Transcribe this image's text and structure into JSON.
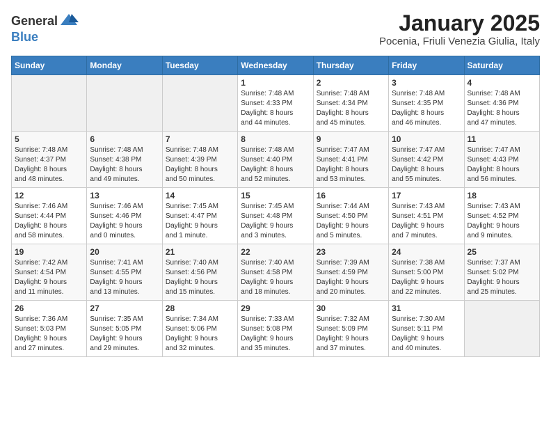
{
  "header": {
    "logo_general": "General",
    "logo_blue": "Blue",
    "title": "January 2025",
    "subtitle": "Pocenia, Friuli Venezia Giulia, Italy"
  },
  "days_of_week": [
    "Sunday",
    "Monday",
    "Tuesday",
    "Wednesday",
    "Thursday",
    "Friday",
    "Saturday"
  ],
  "weeks": [
    [
      {
        "day": "",
        "info": ""
      },
      {
        "day": "",
        "info": ""
      },
      {
        "day": "",
        "info": ""
      },
      {
        "day": "1",
        "info": "Sunrise: 7:48 AM\nSunset: 4:33 PM\nDaylight: 8 hours\nand 44 minutes."
      },
      {
        "day": "2",
        "info": "Sunrise: 7:48 AM\nSunset: 4:34 PM\nDaylight: 8 hours\nand 45 minutes."
      },
      {
        "day": "3",
        "info": "Sunrise: 7:48 AM\nSunset: 4:35 PM\nDaylight: 8 hours\nand 46 minutes."
      },
      {
        "day": "4",
        "info": "Sunrise: 7:48 AM\nSunset: 4:36 PM\nDaylight: 8 hours\nand 47 minutes."
      }
    ],
    [
      {
        "day": "5",
        "info": "Sunrise: 7:48 AM\nSunset: 4:37 PM\nDaylight: 8 hours\nand 48 minutes."
      },
      {
        "day": "6",
        "info": "Sunrise: 7:48 AM\nSunset: 4:38 PM\nDaylight: 8 hours\nand 49 minutes."
      },
      {
        "day": "7",
        "info": "Sunrise: 7:48 AM\nSunset: 4:39 PM\nDaylight: 8 hours\nand 50 minutes."
      },
      {
        "day": "8",
        "info": "Sunrise: 7:48 AM\nSunset: 4:40 PM\nDaylight: 8 hours\nand 52 minutes."
      },
      {
        "day": "9",
        "info": "Sunrise: 7:47 AM\nSunset: 4:41 PM\nDaylight: 8 hours\nand 53 minutes."
      },
      {
        "day": "10",
        "info": "Sunrise: 7:47 AM\nSunset: 4:42 PM\nDaylight: 8 hours\nand 55 minutes."
      },
      {
        "day": "11",
        "info": "Sunrise: 7:47 AM\nSunset: 4:43 PM\nDaylight: 8 hours\nand 56 minutes."
      }
    ],
    [
      {
        "day": "12",
        "info": "Sunrise: 7:46 AM\nSunset: 4:44 PM\nDaylight: 8 hours\nand 58 minutes."
      },
      {
        "day": "13",
        "info": "Sunrise: 7:46 AM\nSunset: 4:46 PM\nDaylight: 9 hours\nand 0 minutes."
      },
      {
        "day": "14",
        "info": "Sunrise: 7:45 AM\nSunset: 4:47 PM\nDaylight: 9 hours\nand 1 minute."
      },
      {
        "day": "15",
        "info": "Sunrise: 7:45 AM\nSunset: 4:48 PM\nDaylight: 9 hours\nand 3 minutes."
      },
      {
        "day": "16",
        "info": "Sunrise: 7:44 AM\nSunset: 4:50 PM\nDaylight: 9 hours\nand 5 minutes."
      },
      {
        "day": "17",
        "info": "Sunrise: 7:43 AM\nSunset: 4:51 PM\nDaylight: 9 hours\nand 7 minutes."
      },
      {
        "day": "18",
        "info": "Sunrise: 7:43 AM\nSunset: 4:52 PM\nDaylight: 9 hours\nand 9 minutes."
      }
    ],
    [
      {
        "day": "19",
        "info": "Sunrise: 7:42 AM\nSunset: 4:54 PM\nDaylight: 9 hours\nand 11 minutes."
      },
      {
        "day": "20",
        "info": "Sunrise: 7:41 AM\nSunset: 4:55 PM\nDaylight: 9 hours\nand 13 minutes."
      },
      {
        "day": "21",
        "info": "Sunrise: 7:40 AM\nSunset: 4:56 PM\nDaylight: 9 hours\nand 15 minutes."
      },
      {
        "day": "22",
        "info": "Sunrise: 7:40 AM\nSunset: 4:58 PM\nDaylight: 9 hours\nand 18 minutes."
      },
      {
        "day": "23",
        "info": "Sunrise: 7:39 AM\nSunset: 4:59 PM\nDaylight: 9 hours\nand 20 minutes."
      },
      {
        "day": "24",
        "info": "Sunrise: 7:38 AM\nSunset: 5:00 PM\nDaylight: 9 hours\nand 22 minutes."
      },
      {
        "day": "25",
        "info": "Sunrise: 7:37 AM\nSunset: 5:02 PM\nDaylight: 9 hours\nand 25 minutes."
      }
    ],
    [
      {
        "day": "26",
        "info": "Sunrise: 7:36 AM\nSunset: 5:03 PM\nDaylight: 9 hours\nand 27 minutes."
      },
      {
        "day": "27",
        "info": "Sunrise: 7:35 AM\nSunset: 5:05 PM\nDaylight: 9 hours\nand 29 minutes."
      },
      {
        "day": "28",
        "info": "Sunrise: 7:34 AM\nSunset: 5:06 PM\nDaylight: 9 hours\nand 32 minutes."
      },
      {
        "day": "29",
        "info": "Sunrise: 7:33 AM\nSunset: 5:08 PM\nDaylight: 9 hours\nand 35 minutes."
      },
      {
        "day": "30",
        "info": "Sunrise: 7:32 AM\nSunset: 5:09 PM\nDaylight: 9 hours\nand 37 minutes."
      },
      {
        "day": "31",
        "info": "Sunrise: 7:30 AM\nSunset: 5:11 PM\nDaylight: 9 hours\nand 40 minutes."
      },
      {
        "day": "",
        "info": ""
      }
    ]
  ]
}
